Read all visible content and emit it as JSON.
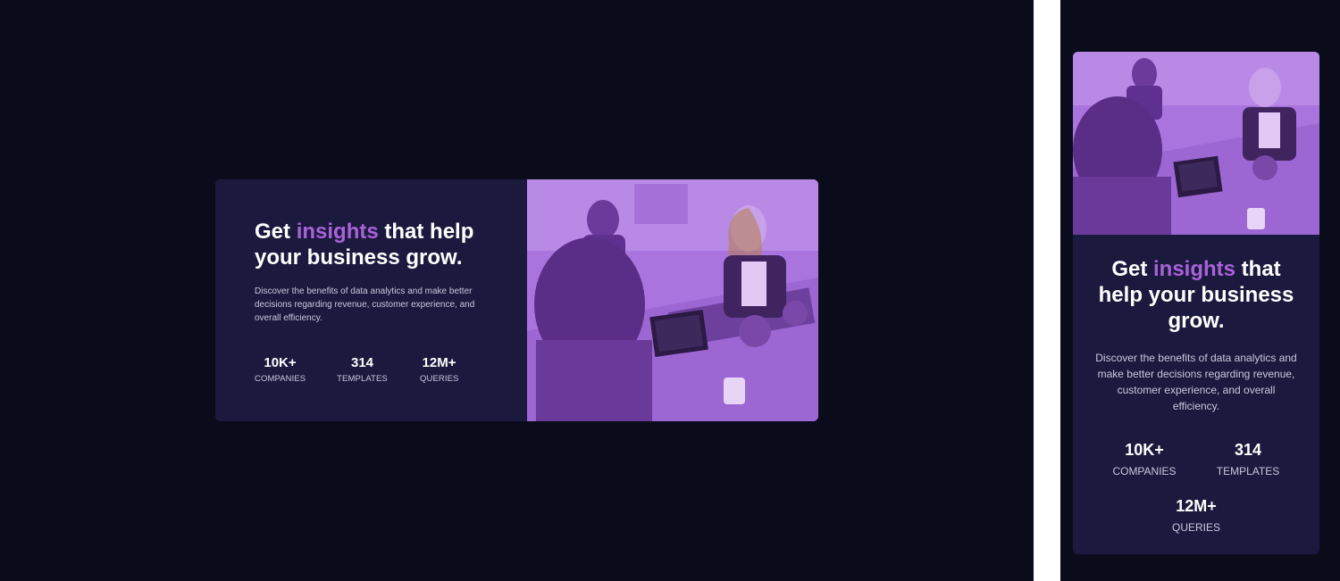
{
  "card": {
    "title_pre": "Get ",
    "title_accent": "insights",
    "title_post": " that help your business grow.",
    "description": "Discover the benefits of data analytics and make better decisions regarding revenue, customer experience, and overall efficiency.",
    "stats": [
      {
        "value": "10K+",
        "label": "COMPANIES"
      },
      {
        "value": "314",
        "label": "TEMPLATES"
      },
      {
        "value": "12M+",
        "label": "QUERIES"
      }
    ]
  },
  "colors": {
    "background": "#0a0c1c",
    "card": "#1b1a3e",
    "accent": "#a962d8",
    "image_overlay": "#aa5cdb"
  },
  "image": {
    "icon": "office-photo-image"
  }
}
